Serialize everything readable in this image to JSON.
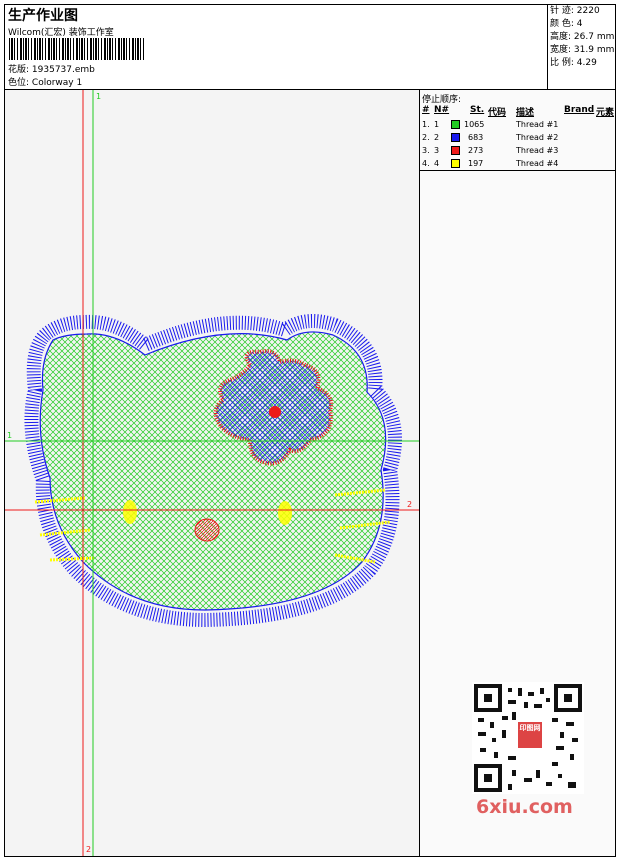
{
  "header": {
    "title": "生产作业图",
    "company": "Wilcom(汇宏) 装饰工作室",
    "design_label": "花版:",
    "design_value": "1935737.emb",
    "colorway_label": "色位:",
    "colorway_value": "Colorway 1"
  },
  "stats": [
    {
      "label": "针 迹:",
      "value": "2220"
    },
    {
      "label": "颜 色:",
      "value": "4"
    },
    {
      "label": "高度:",
      "value": "26.7 mm"
    },
    {
      "label": "宽度:",
      "value": "31.9 mm"
    },
    {
      "label": "比 例:",
      "value": "4.29"
    }
  ],
  "thread_panel": {
    "stop_sequence_label": "停止顺序:",
    "columns": {
      "num": "#",
      "n": "N#",
      "st": "St.",
      "code": "代码",
      "desc": "描述",
      "brand": "Brand",
      "element": "元素"
    },
    "rows": [
      {
        "num": "1.",
        "n": "1",
        "st": "1065",
        "desc": "Thread #1",
        "color": "#22cc22"
      },
      {
        "num": "2.",
        "n": "2",
        "st": "683",
        "desc": "Thread #2",
        "color": "#1a1aee"
      },
      {
        "num": "3.",
        "n": "3",
        "st": "273",
        "desc": "Thread #3",
        "color": "#ee1a1a"
      },
      {
        "num": "4.",
        "n": "4",
        "st": "197",
        "desc": "Thread #4",
        "color": "#ffff00"
      }
    ]
  },
  "guides": {
    "top": "1",
    "left": "1",
    "right": "2",
    "bottom": "2"
  },
  "watermark": {
    "site": "6xiu.com",
    "stamp": "印图网"
  }
}
